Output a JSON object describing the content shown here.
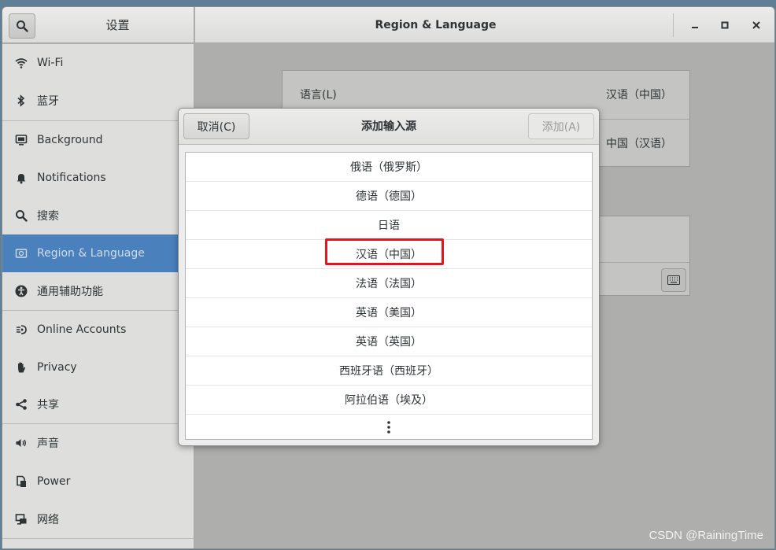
{
  "window": {
    "sidebar_title": "设置",
    "panel_title": "Region & Language",
    "minimize_label": "_",
    "maximize_label": "□",
    "close_label": "×"
  },
  "sidebar": {
    "items": [
      {
        "label": "Wi-Fi",
        "icon": "wifi-icon"
      },
      {
        "label": "蓝牙",
        "icon": "bluetooth-icon"
      },
      {
        "label": "Background",
        "icon": "background-icon"
      },
      {
        "label": "Notifications",
        "icon": "bell-icon"
      },
      {
        "label": "搜索",
        "icon": "search-icon"
      },
      {
        "label": "Region & Language",
        "icon": "region-icon",
        "active": true
      },
      {
        "label": "通用辅助功能",
        "icon": "accessibility-icon"
      },
      {
        "label": "Online Accounts",
        "icon": "online-accounts-icon"
      },
      {
        "label": "Privacy",
        "icon": "hand-icon"
      },
      {
        "label": "共享",
        "icon": "share-icon"
      },
      {
        "label": "声音",
        "icon": "speaker-icon"
      },
      {
        "label": "Power",
        "icon": "power-icon"
      },
      {
        "label": "网络",
        "icon": "network-icon"
      }
    ]
  },
  "main": {
    "language_label": "语言(L)",
    "language_value": "汉语（中国）",
    "formats_value": "中国（汉语）"
  },
  "dialog": {
    "cancel_label": "取消(C)",
    "title": "添加输入源",
    "add_label": "添加(A)",
    "items": [
      "俄语（俄罗斯）",
      "德语（德国）",
      "日语",
      "汉语（中国）",
      "法语（法国）",
      "英语（美国）",
      "英语（英国）",
      "西班牙语（西班牙）",
      "阿拉伯语（埃及）"
    ],
    "highlighted_index": 3
  },
  "watermark": "CSDN @RainingTime",
  "colors": {
    "accent": "#4a81bd",
    "highlight_border": "#e4151e"
  }
}
